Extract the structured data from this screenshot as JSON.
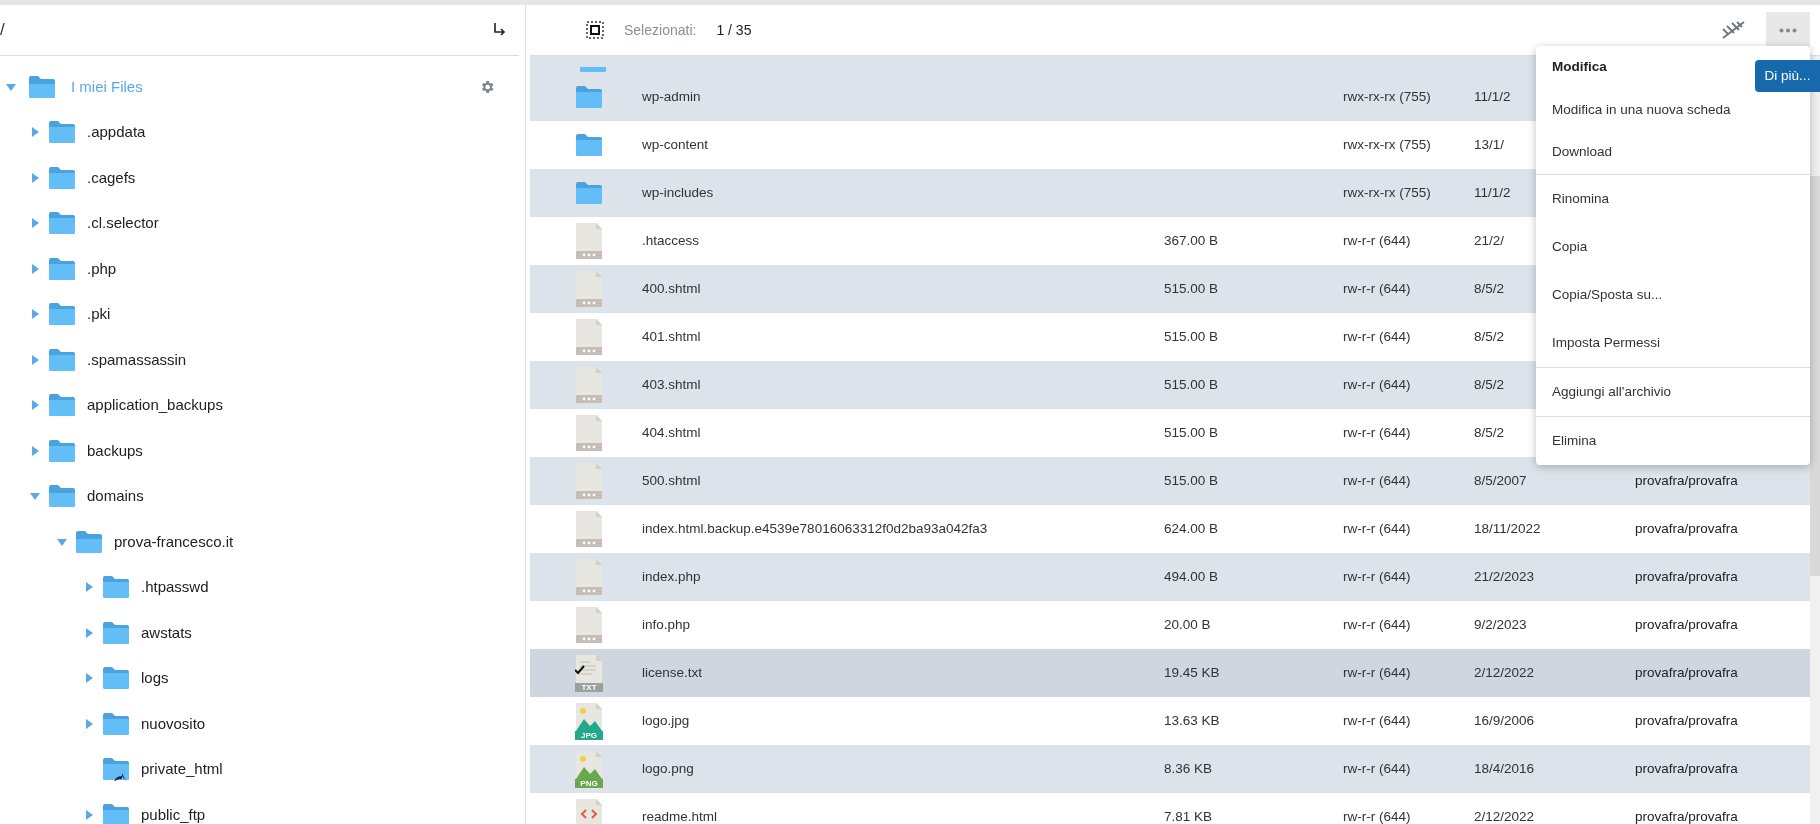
{
  "path_bar": {
    "path": "/"
  },
  "tree": {
    "label": "I miei Files",
    "expanded": true,
    "children": [
      {
        "label": ".appdata",
        "kind": "folder",
        "expanded": false
      },
      {
        "label": ".cagefs",
        "kind": "folder",
        "expanded": false
      },
      {
        "label": ".cl.selector",
        "kind": "folder",
        "expanded": false
      },
      {
        "label": ".php",
        "kind": "folder",
        "expanded": false
      },
      {
        "label": ".pki",
        "kind": "folder",
        "expanded": false
      },
      {
        "label": ".spamassassin",
        "kind": "folder",
        "expanded": false
      },
      {
        "label": "application_backups",
        "kind": "folder",
        "expanded": false
      },
      {
        "label": "backups",
        "kind": "folder",
        "expanded": false
      },
      {
        "label": "domains",
        "kind": "folder",
        "expanded": true,
        "children": [
          {
            "label": "prova-francesco.it",
            "kind": "folder",
            "expanded": true,
            "children": [
              {
                "label": ".htpasswd",
                "kind": "folder",
                "expanded": false
              },
              {
                "label": "awstats",
                "kind": "folder",
                "expanded": false
              },
              {
                "label": "logs",
                "kind": "folder",
                "expanded": false
              },
              {
                "label": "nuovosito",
                "kind": "folder",
                "expanded": false
              },
              {
                "label": "private_html",
                "kind": "link",
                "expanded": false
              },
              {
                "label": "public_ftp",
                "kind": "folder",
                "expanded": false
              }
            ]
          }
        ]
      }
    ]
  },
  "toolbar": {
    "selected_label": "Selezionati:",
    "selected_count": "1 / 35"
  },
  "rows": [
    {
      "kind": "folder",
      "name": "wp-admin",
      "size": "",
      "permissions": "rwx-rx-rx (755)",
      "date": "11/1/2",
      "owner": "",
      "selected": false
    },
    {
      "kind": "folder",
      "name": "wp-content",
      "size": "",
      "permissions": "rwx-rx-rx (755)",
      "date": "13/1/",
      "owner": "",
      "selected": false
    },
    {
      "kind": "folder",
      "name": "wp-includes",
      "size": "",
      "permissions": "rwx-rx-rx (755)",
      "date": "11/1/2",
      "owner": "",
      "selected": false
    },
    {
      "kind": "file",
      "name": ".htaccess",
      "size": "367.00 B",
      "permissions": "rw-r-r (644)",
      "date": "21/2/",
      "owner": "",
      "selected": false
    },
    {
      "kind": "file",
      "name": "400.shtml",
      "size": "515.00 B",
      "permissions": "rw-r-r (644)",
      "date": "8/5/2",
      "owner": "",
      "selected": false
    },
    {
      "kind": "file",
      "name": "401.shtml",
      "size": "515.00 B",
      "permissions": "rw-r-r (644)",
      "date": "8/5/2",
      "owner": "",
      "selected": false
    },
    {
      "kind": "file",
      "name": "403.shtml",
      "size": "515.00 B",
      "permissions": "rw-r-r (644)",
      "date": "8/5/2",
      "owner": "",
      "selected": false
    },
    {
      "kind": "file",
      "name": "404.shtml",
      "size": "515.00 B",
      "permissions": "rw-r-r (644)",
      "date": "8/5/2",
      "owner": "",
      "selected": false
    },
    {
      "kind": "file",
      "name": "500.shtml",
      "size": "515.00 B",
      "permissions": "rw-r-r (644)",
      "date": "8/5/2007",
      "owner": "provafra/provafra",
      "selected": false
    },
    {
      "kind": "file",
      "name": "index.html.backup.e4539e78016063312f0d2ba93a042fa3",
      "size": "624.00 B",
      "permissions": "rw-r-r (644)",
      "date": "18/11/2022",
      "owner": "provafra/provafra",
      "selected": false
    },
    {
      "kind": "file",
      "name": "index.php",
      "size": "494.00 B",
      "permissions": "rw-r-r (644)",
      "date": "21/2/2023",
      "owner": "provafra/provafra",
      "selected": false
    },
    {
      "kind": "file",
      "name": "info.php",
      "size": "20.00 B",
      "permissions": "rw-r-r (644)",
      "date": "9/2/2023",
      "owner": "provafra/provafra",
      "selected": false
    },
    {
      "kind": "text",
      "badge": "TXT",
      "name": "license.txt",
      "size": "19.45 KB",
      "permissions": "rw-r-r (644)",
      "date": "2/12/2022",
      "owner": "provafra/provafra",
      "selected": true
    },
    {
      "kind": "image",
      "badge": "JPG",
      "color": "#22a88a",
      "name": "logo.jpg",
      "size": "13.63 KB",
      "permissions": "rw-r-r (644)",
      "date": "16/9/2006",
      "owner": "provafra/provafra",
      "selected": false
    },
    {
      "kind": "image",
      "badge": "PNG",
      "color": "#6aa84f",
      "name": "logo.png",
      "size": "8.36 KB",
      "permissions": "rw-r-r (644)",
      "date": "18/4/2016",
      "owner": "provafra/provafra",
      "selected": false
    },
    {
      "kind": "html",
      "name": "readme.html",
      "size": "7.81 KB",
      "permissions": "rw-r-r (644)",
      "date": "2/12/2022",
      "owner": "provafra/provafra",
      "selected": false
    }
  ],
  "context_menu": {
    "groups": [
      [
        {
          "label": "Modifica",
          "bold": true
        },
        {
          "label": "Modifica in una nuova scheda",
          "bold": false
        },
        {
          "label": "Download",
          "bold": false
        }
      ],
      [
        {
          "label": "Rinomina",
          "bold": false
        },
        {
          "label": "Copia",
          "bold": false
        },
        {
          "label": "Copia/Sposta su...",
          "bold": false
        },
        {
          "label": "Imposta Permessi",
          "bold": false
        }
      ],
      [
        {
          "label": "Aggiungi all'archivio",
          "bold": false
        }
      ],
      [
        {
          "label": "Elimina",
          "bold": false
        }
      ]
    ],
    "more_button": "Di più..."
  }
}
